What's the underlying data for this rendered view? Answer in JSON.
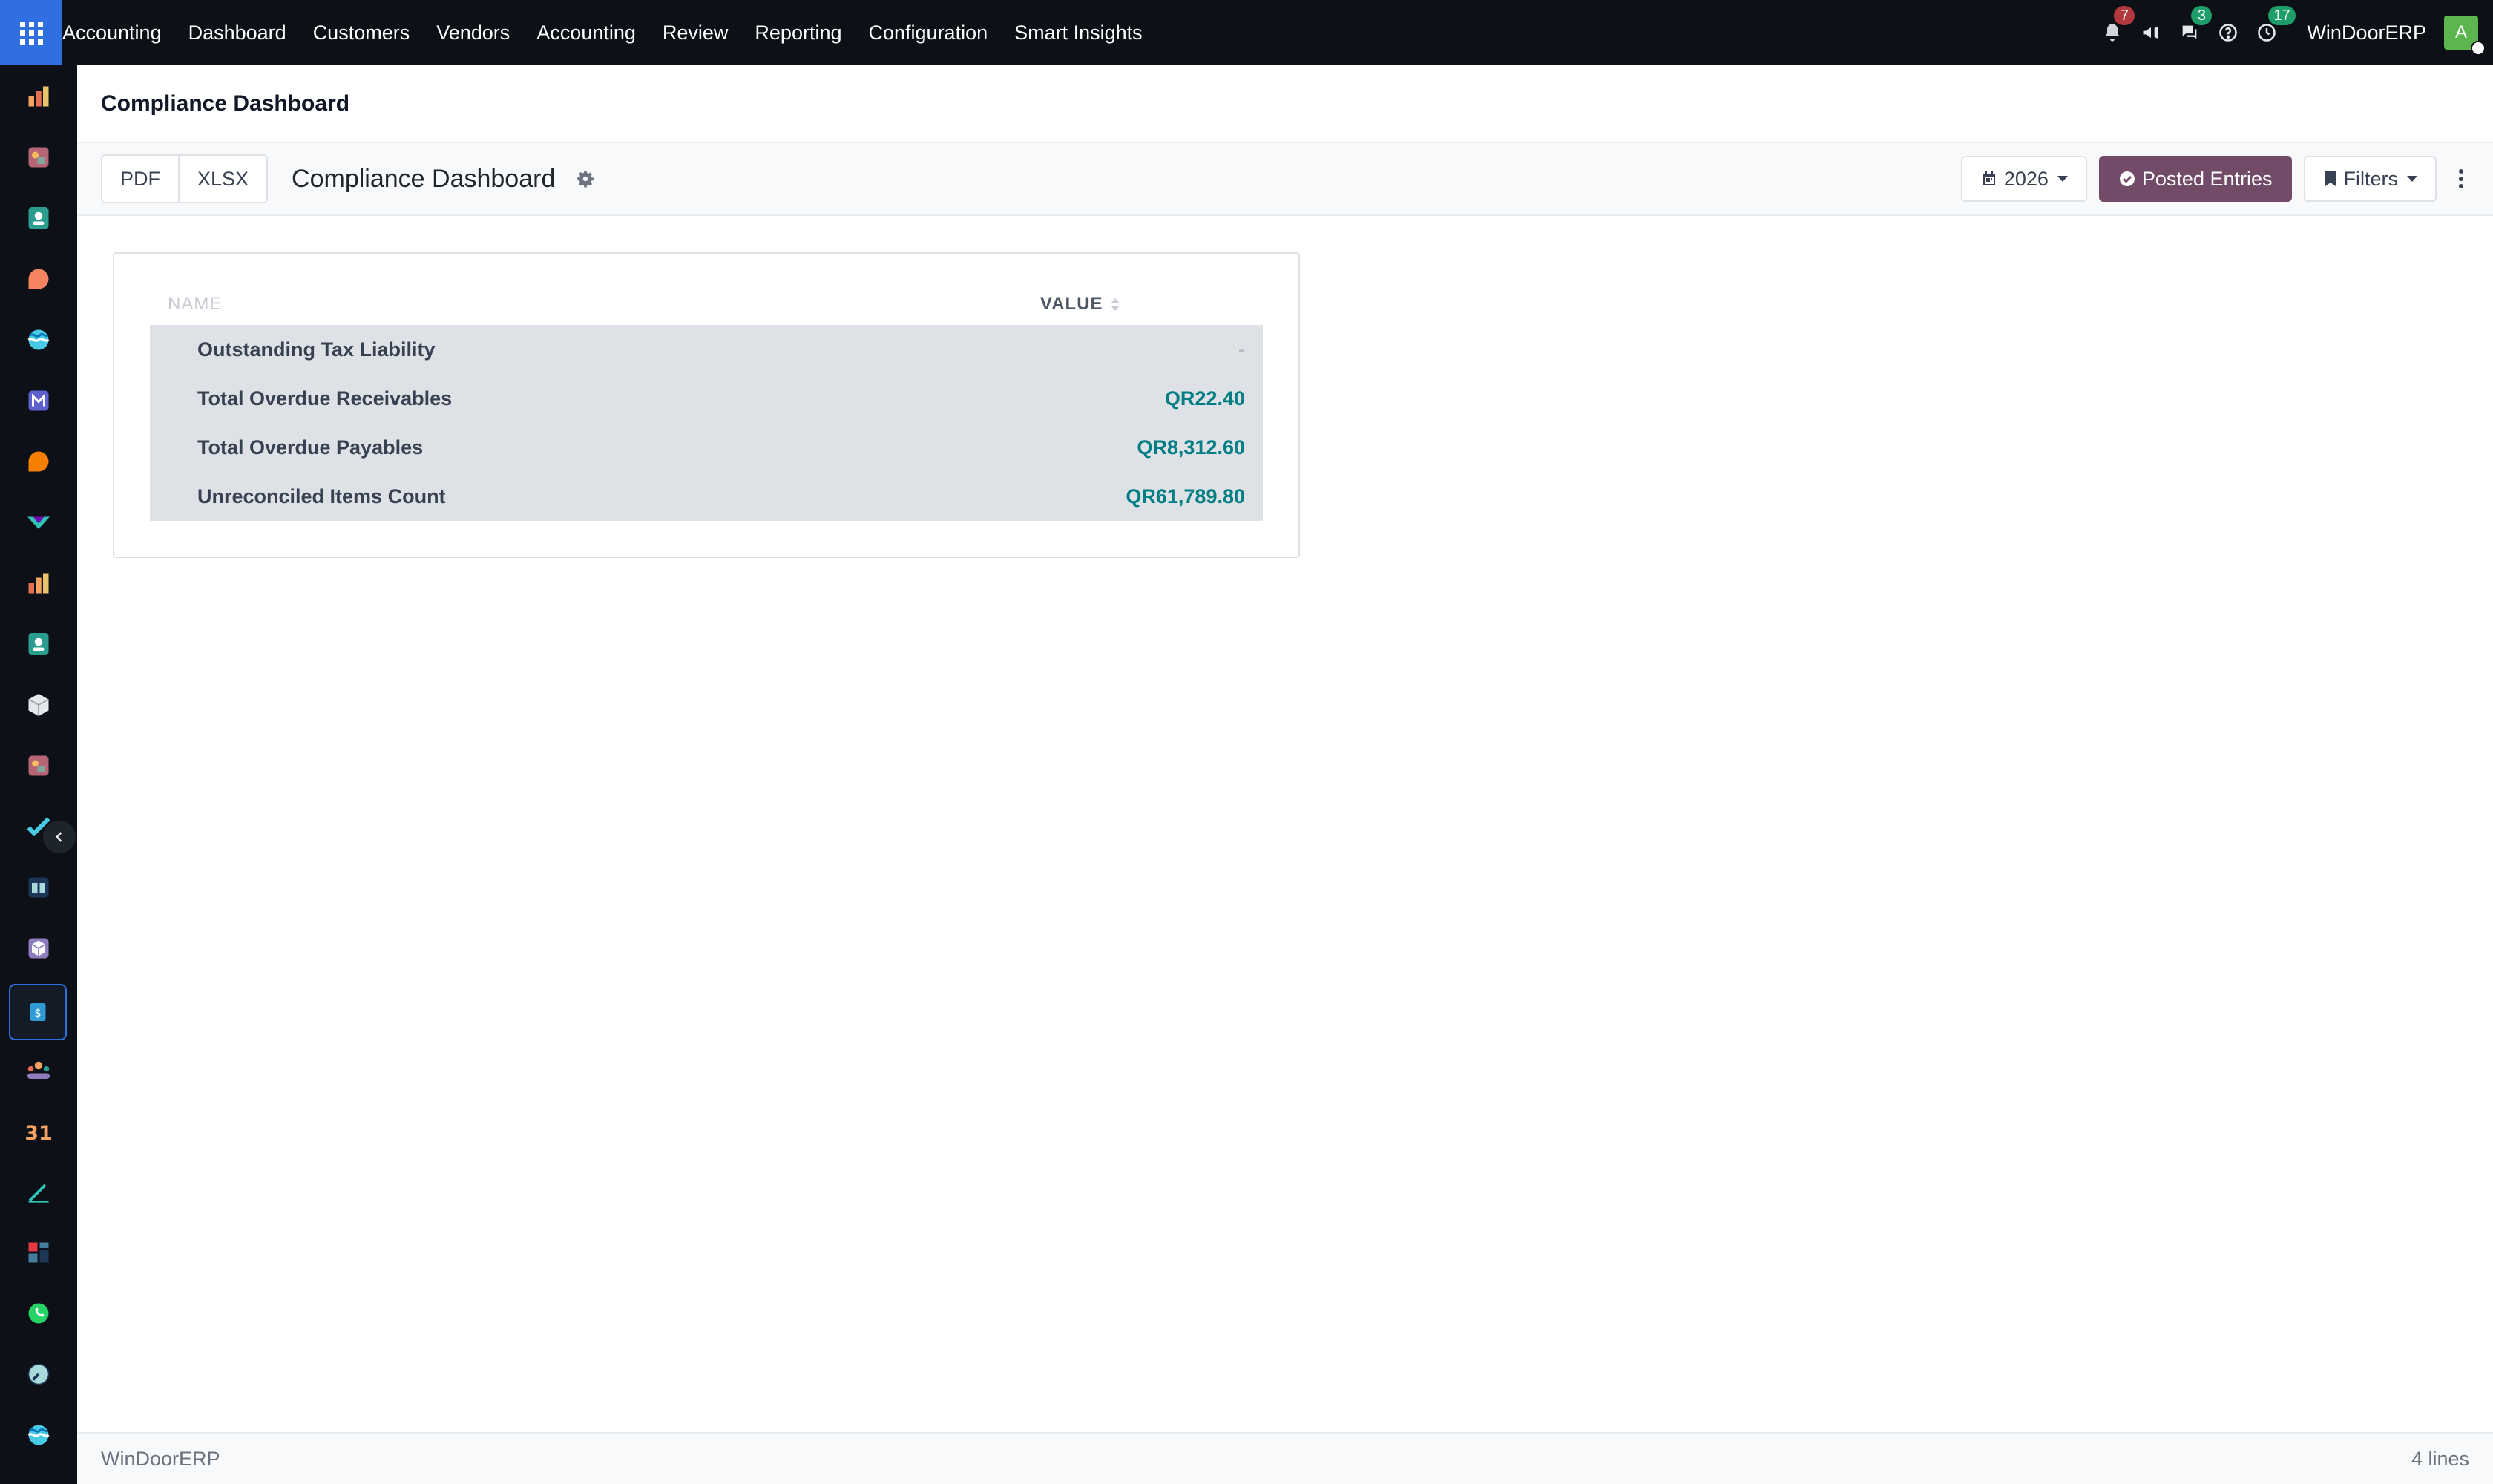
{
  "navbar": {
    "menu": [
      "Accounting",
      "Dashboard",
      "Customers",
      "Vendors",
      "Accounting",
      "Review",
      "Reporting",
      "Configuration",
      "Smart Insights"
    ],
    "notifications_count": "7",
    "messages_count": "3",
    "activities_count": "17",
    "company": "WinDoorERP",
    "avatar_initial": "A"
  },
  "breadcrumb": {
    "title": "Compliance Dashboard"
  },
  "controls": {
    "export_pdf": "PDF",
    "export_xlsx": "XLSX",
    "report_title": "Compliance Dashboard",
    "date_filter": "2026",
    "posted_entries": "Posted Entries",
    "filters": "Filters"
  },
  "table": {
    "columns": {
      "name": "NAME",
      "value": "VALUE"
    },
    "rows": [
      {
        "label": "Outstanding Tax Liability",
        "value": "-"
      },
      {
        "label": "Total Overdue Receivables",
        "value": "QR22.40"
      },
      {
        "label": "Total Overdue Payables",
        "value": "QR8,312.60"
      },
      {
        "label": "Unreconciled Items Count",
        "value": "QR61,789.80"
      }
    ]
  },
  "footer": {
    "company": "WinDoorERP",
    "lines": "4 lines"
  },
  "colors": {
    "brand_blue": "#2f6fe0",
    "primary_button": "#714b67",
    "value_teal": "#017e84",
    "navbar_bg": "#0d1117"
  },
  "sidebar_icons": [
    "accounting-icon",
    "sales-icon",
    "contacts-icon",
    "discuss-icon",
    "website-icon",
    "email-marketing-icon",
    "livechat-icon",
    "purchase-icon",
    "reporting-icon",
    "employees-icon",
    "inventory-icon",
    "crm-icon",
    "project-icon",
    "knowledge-icon",
    "manufacturing-icon",
    "invoicing-icon",
    "team-icon",
    "calendar-icon",
    "sign-icon",
    "dashboards-icon",
    "whatsapp-icon",
    "time-off-icon",
    "website-icon"
  ]
}
